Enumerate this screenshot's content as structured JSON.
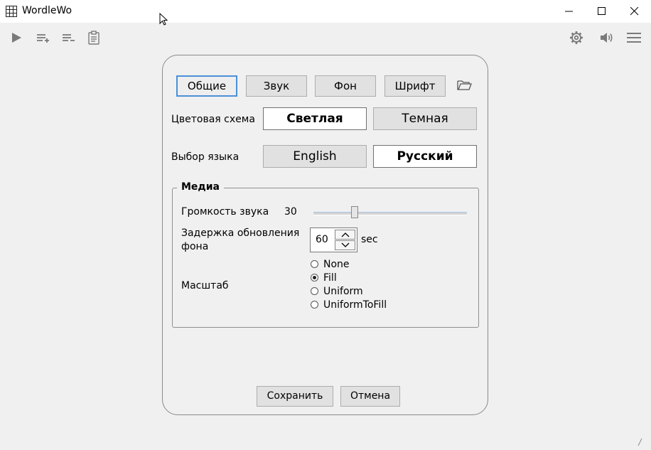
{
  "window": {
    "title": "WordleWo"
  },
  "tabs": [
    {
      "label": "Общие",
      "active": true
    },
    {
      "label": "Звук",
      "active": false
    },
    {
      "label": "Фон",
      "active": false
    },
    {
      "label": "Шрифт",
      "active": false
    }
  ],
  "color_scheme": {
    "label": "Цветовая схема",
    "options": [
      {
        "label": "Светлая",
        "selected": true
      },
      {
        "label": "Темная",
        "selected": false
      }
    ]
  },
  "language": {
    "label": "Выбор языка",
    "options": [
      {
        "label": "English",
        "selected": false
      },
      {
        "label": "Русский",
        "selected": true
      }
    ]
  },
  "media": {
    "legend": "Медиа",
    "volume_label": "Громкость звука",
    "volume_value": "30",
    "volume_level": 0.3,
    "delay_label_line1": "Задержка обновления",
    "delay_label_line2": "фона",
    "delay_value": "60",
    "delay_unit": "sec",
    "scale_label": "Масштаб",
    "scale_options": [
      {
        "label": "None",
        "checked": false
      },
      {
        "label": "Fill",
        "checked": true
      },
      {
        "label": "Uniform",
        "checked": false
      },
      {
        "label": "UniformToFill",
        "checked": false
      }
    ]
  },
  "footer": {
    "save_label": "Сохранить",
    "cancel_label": "Отмена"
  },
  "colors": {
    "accent_border": "#4a90d9",
    "icon_gray": "#7a7a7a"
  }
}
